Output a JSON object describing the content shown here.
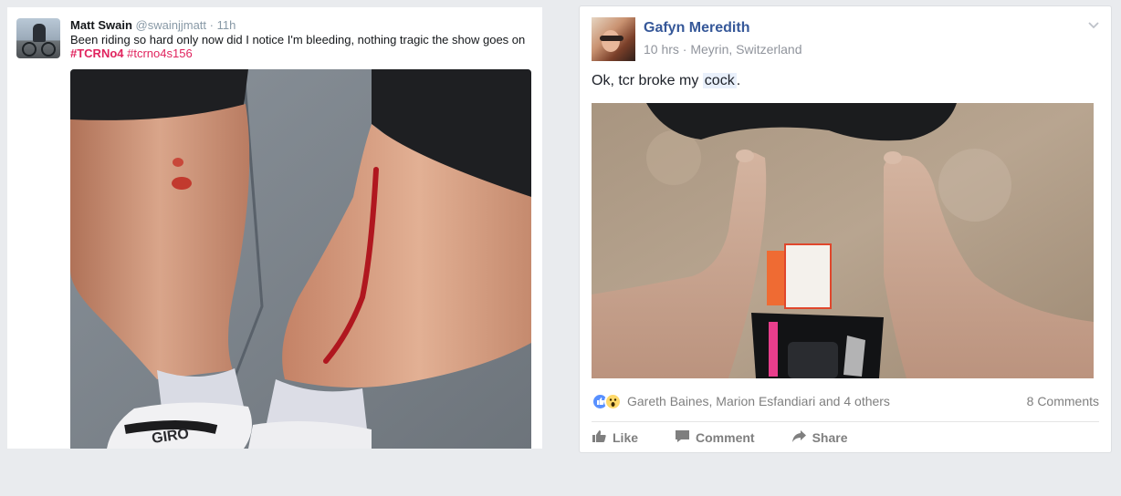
{
  "tweet": {
    "name": "Matt Swain",
    "handle": "@swainjjmatt",
    "separator": "·",
    "time": "11h",
    "text_before": "Been riding so hard only now did I notice I'm bleeding, nothing tragic the show goes on ",
    "hashtag_1": "#TCRNo4",
    "hashtag_2": "#tcrno4s156",
    "shoe_brand": "GIRO",
    "colors": {
      "hashtag": "#e0245e",
      "name": "#14171a",
      "muted": "#8899a6"
    },
    "icons": {
      "avatar": "cyclist-avatar-icon"
    }
  },
  "facebook": {
    "name": "Gafyn Meredith",
    "meta": "10 hrs · Meyrin, Switzerland",
    "post_text_before": "Ok, tcr broke my ",
    "post_text_highlight": "cock",
    "post_text_after": ".",
    "reactors": "Gareth Baines, Marion Esfandiari and 4 others",
    "comments_count": "8 Comments",
    "actions": {
      "like": "Like",
      "comment": "Comment",
      "share": "Share"
    },
    "colors": {
      "name": "#365899",
      "muted": "#90949c",
      "action": "#7f7f7f"
    },
    "icons": {
      "menu": "chevron-down-icon",
      "reaction_like": "like-reaction-icon",
      "reaction_wow": "wow-reaction-icon",
      "like": "thumbs-up-icon",
      "comment": "comment-icon",
      "share": "share-arrow-icon"
    }
  }
}
